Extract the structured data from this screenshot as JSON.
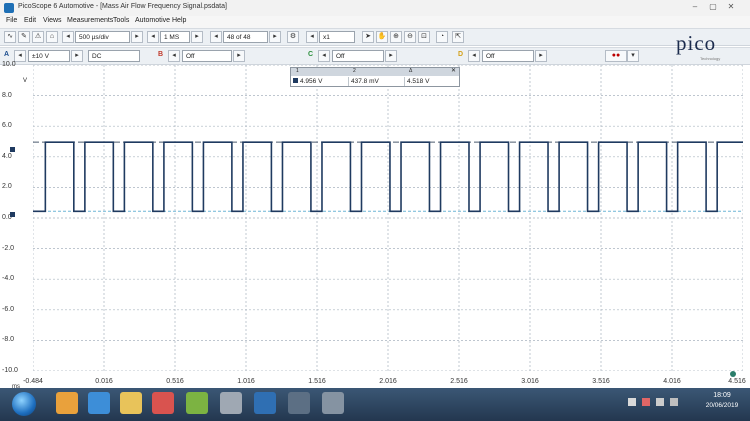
{
  "window": {
    "title": "PicoScope 6 Automotive - [Mass Air Flow Frequency Signal.psdata]",
    "controls": [
      "–",
      "▢",
      "✕"
    ]
  },
  "menu": [
    "File",
    "Edit",
    "Views",
    "Measurements",
    "Tools",
    "Automotive",
    "Help"
  ],
  "toolbar1": {
    "timebase": "500 µs/div",
    "samples": "1 MS",
    "buffer": "48 of 48",
    "zoom": "x1"
  },
  "toolbar2": {
    "channel_a": {
      "label": "A",
      "range": "±10 V",
      "coupling": "DC"
    },
    "channel_b": {
      "label": "B",
      "value": "Off"
    },
    "channel_c": {
      "label": "C",
      "value": "Off"
    },
    "channel_d": {
      "label": "D",
      "value": "Off"
    }
  },
  "logo": {
    "text": "pico",
    "subtext": "Technology"
  },
  "rulers": {
    "headers": [
      "1",
      "2",
      "Δ"
    ],
    "values": [
      "4.956 V",
      "437.8 mV",
      "4.518 V"
    ]
  },
  "chart_data": {
    "type": "line",
    "title": "",
    "xlabel": "ms",
    "ylabel": "V",
    "xlim": [
      -0.484,
      4.516
    ],
    "ylim": [
      -10.0,
      10.0
    ],
    "grid": true,
    "x_ticks": [
      "-0.484",
      "0.016",
      "0.516",
      "1.016",
      "1.516",
      "2.016",
      "2.516",
      "3.016",
      "3.516",
      "4.016",
      "4.516"
    ],
    "y_ticks": [
      "10.0",
      "8.0",
      "6.0",
      "4.0",
      "2.0",
      "0.0",
      "-2.0",
      "-4.0",
      "-6.0",
      "-8.0",
      "-10.0"
    ],
    "y_unit": "V",
    "x_unit": "ms",
    "series": [
      {
        "signal": "square",
        "high": 4.956,
        "low": 0.438,
        "period": 0.2783,
        "first_rise": -0.397,
        "duty": 0.72,
        "color": "#1f3a60"
      }
    ],
    "rulers": [
      4.956,
      0.438
    ],
    "ruler_color": "#4b5b6e",
    "ruler2_color": "#6fb6d6"
  },
  "taskbar": {
    "time": "18:09",
    "date": "20/06/2019"
  }
}
